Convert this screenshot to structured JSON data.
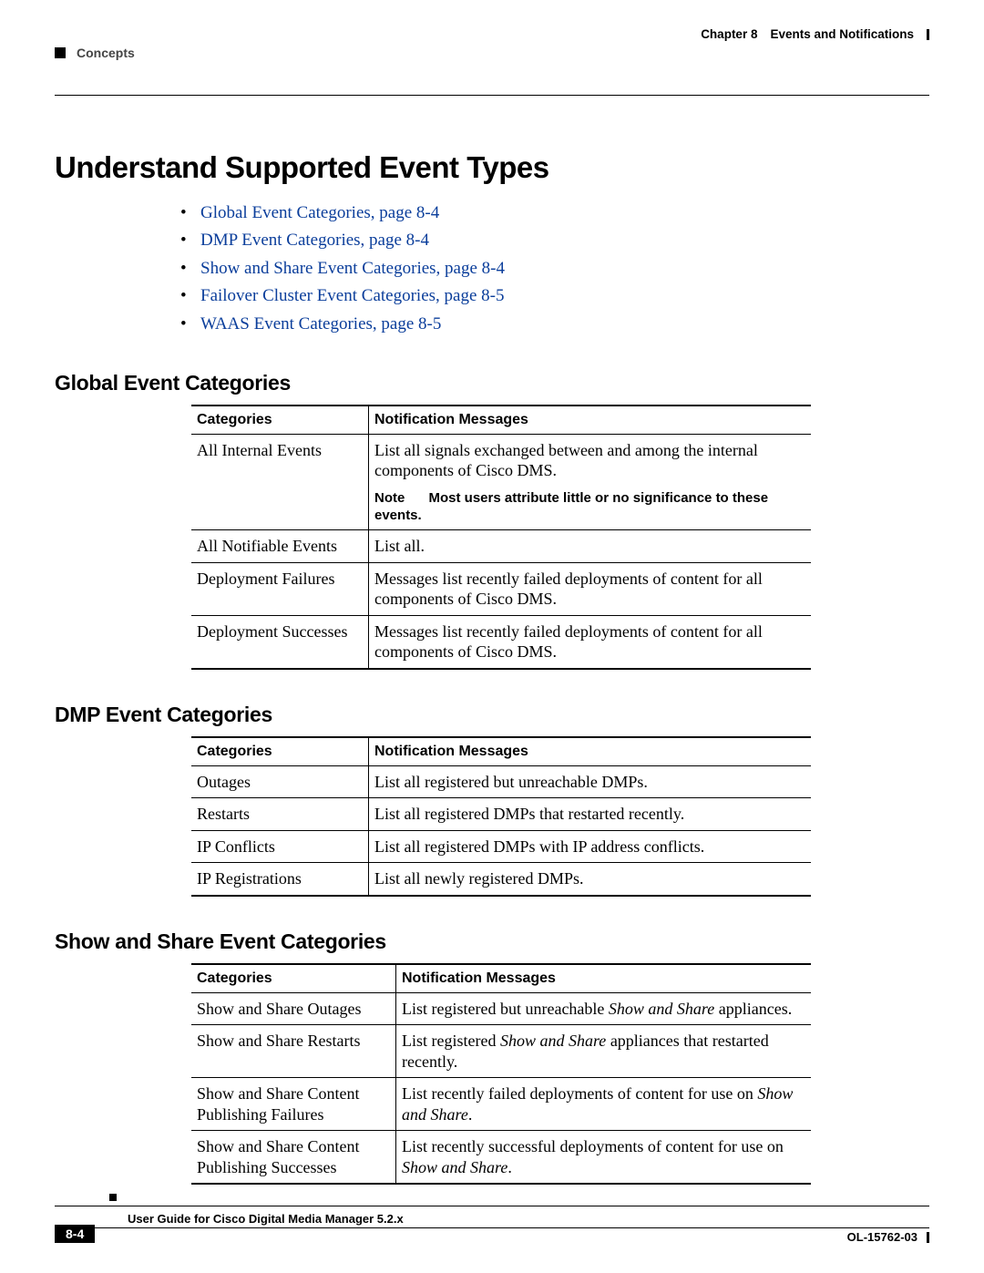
{
  "header": {
    "sectionLabel": "Concepts",
    "chapterLabel": "Chapter 8",
    "chapterTitle": "Events and Notifications"
  },
  "title": "Understand Supported Event Types",
  "toc": [
    "Global Event Categories, page 8-4",
    "DMP Event Categories, page 8-4",
    "Show and Share Event Categories, page 8-4",
    "Failover Cluster Event Categories, page 8-5",
    "WAAS Event Categories, page 8-5"
  ],
  "subheadings": {
    "global": "Global Event Categories",
    "dmp": "DMP Event Categories",
    "show": "Show and Share Event Categories"
  },
  "tableHeaders": {
    "categories": "Categories",
    "messages": "Notification Messages"
  },
  "globalRows": {
    "r0": {
      "cat": "All Internal Events",
      "msg": "List all signals exchanged between and among the internal components of Cisco DMS."
    },
    "r1": {
      "cat": "All Notifiable Events",
      "msg": "List all."
    },
    "r2": {
      "cat": "Deployment Failures",
      "msg": "Messages list recently failed deployments of content for all components of Cisco DMS."
    },
    "r3": {
      "cat": "Deployment Successes",
      "msg": "Messages list recently failed deployments of content for all components of Cisco DMS."
    }
  },
  "globalNote": {
    "label": "Note",
    "text": "Most users attribute little or no significance to these events."
  },
  "dmpRows": {
    "r0": {
      "cat": "Outages",
      "msg": "List all registered but unreachable DMPs."
    },
    "r1": {
      "cat": "Restarts",
      "msg": "List all registered DMPs that restarted recently."
    },
    "r2": {
      "cat": "IP Conflicts",
      "msg": "List all registered DMPs with IP address conflicts."
    },
    "r3": {
      "cat": "IP Registrations",
      "msg": "List all newly registered DMPs."
    }
  },
  "showRows": {
    "r0": {
      "cat": "Show and Share Outages",
      "pre": "List registered but unreachable ",
      "it": "Show and Share",
      "post": " appliances."
    },
    "r1": {
      "cat": "Show and Share Restarts",
      "pre": "List registered ",
      "it": "Show and Share",
      "post": " appliances that restarted recently."
    },
    "r2": {
      "cat": "Show and Share Content Publishing Failures",
      "pre": "List recently failed deployments of content for use on ",
      "it": "Show and Share",
      "post": "."
    },
    "r3": {
      "cat": "Show and Share Content Publishing Successes",
      "pre": "List recently successful deployments of content for use on ",
      "it": "Show and Share",
      "post": "."
    }
  },
  "footer": {
    "guide": "User Guide for Cisco Digital Media Manager 5.2.x",
    "page": "8-4",
    "docid": "OL-15762-03"
  }
}
